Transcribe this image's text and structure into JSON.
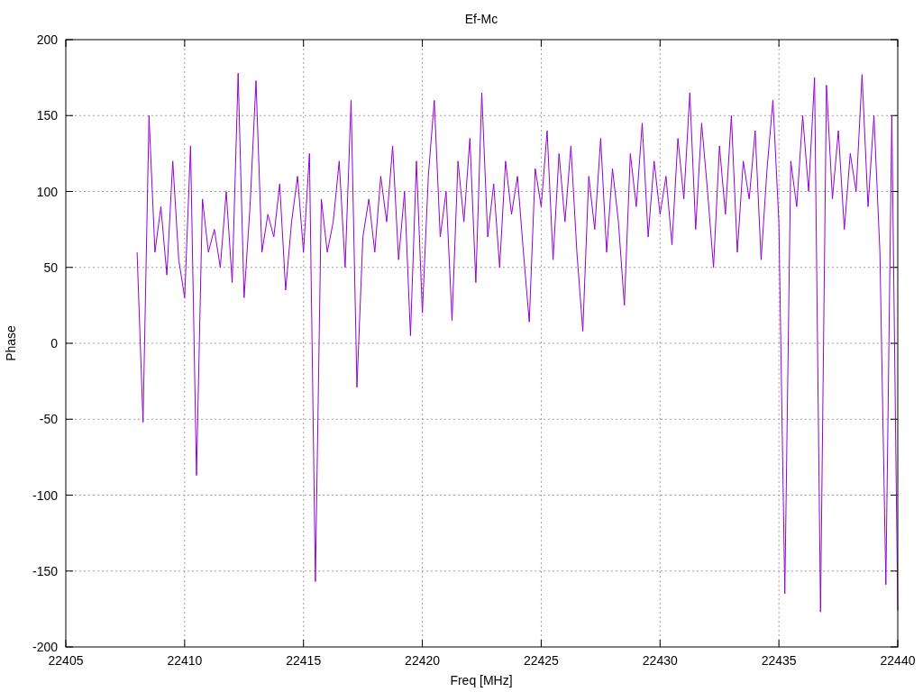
{
  "chart_data": {
    "type": "line",
    "title": "Ef-Mc",
    "xlabel": "Freq [MHz]",
    "ylabel": "Phase",
    "xlim": [
      22405,
      22440
    ],
    "ylim": [
      -200,
      200
    ],
    "xticks": [
      22405,
      22410,
      22415,
      22420,
      22425,
      22430,
      22435,
      22440
    ],
    "yticks": [
      -200,
      -150,
      -100,
      -50,
      0,
      50,
      100,
      150,
      200
    ],
    "x": [
      22408,
      22408.25,
      22408.5,
      22408.75,
      22409,
      22409.25,
      22409.5,
      22409.75,
      22410,
      22410.25,
      22410.5,
      22410.75,
      22411,
      22411.25,
      22411.5,
      22411.75,
      22412,
      22412.25,
      22412.5,
      22412.75,
      22413,
      22413.25,
      22413.5,
      22413.75,
      22414,
      22414.25,
      22414.5,
      22414.75,
      22415,
      22415.25,
      22415.5,
      22415.75,
      22416,
      22416.25,
      22416.5,
      22416.75,
      22417,
      22417.25,
      22417.5,
      22417.75,
      22418,
      22418.25,
      22418.5,
      22418.75,
      22419,
      22419.25,
      22419.5,
      22419.75,
      22420,
      22420.25,
      22420.5,
      22420.75,
      22421,
      22421.25,
      22421.5,
      22421.75,
      22422,
      22422.25,
      22422.5,
      22422.75,
      22423,
      22423.25,
      22423.5,
      22423.75,
      22424,
      22424.25,
      22424.5,
      22424.75,
      22425,
      22425.25,
      22425.5,
      22425.75,
      22426,
      22426.25,
      22426.5,
      22426.75,
      22427,
      22427.25,
      22427.5,
      22427.75,
      22428,
      22428.25,
      22428.5,
      22428.75,
      22429,
      22429.25,
      22429.5,
      22429.75,
      22430,
      22430.25,
      22430.5,
      22430.75,
      22431,
      22431.25,
      22431.5,
      22431.75,
      22432,
      22432.25,
      22432.5,
      22432.75,
      22433,
      22433.25,
      22433.5,
      22433.75,
      22434,
      22434.25,
      22434.5,
      22434.75,
      22435,
      22435.25,
      22435.5,
      22435.75,
      22436,
      22436.25,
      22436.5,
      22436.75,
      22437,
      22437.25,
      22437.5,
      22437.75,
      22438,
      22438.25,
      22438.5,
      22438.75,
      22439,
      22439.25,
      22439.5,
      22439.75,
      22440
    ],
    "grid": true,
    "series": [
      {
        "color": "#9400d3",
        "values": [
          60,
          -52,
          150,
          60,
          90,
          45,
          120,
          55,
          30,
          130,
          -87,
          95,
          60,
          75,
          50,
          100,
          40,
          178,
          30,
          90,
          173,
          60,
          85,
          70,
          105,
          35,
          80,
          110,
          60,
          125,
          -157,
          95,
          60,
          80,
          120,
          50,
          160,
          -29,
          70,
          95,
          60,
          110,
          80,
          130,
          55,
          100,
          5,
          120,
          20,
          110,
          160,
          70,
          100,
          15,
          120,
          80,
          135,
          40,
          165,
          70,
          105,
          50,
          120,
          85,
          110,
          60,
          14,
          115,
          90,
          140,
          55,
          125,
          80,
          130,
          60,
          8,
          110,
          75,
          135,
          60,
          115,
          80,
          25,
          125,
          90,
          145,
          70,
          120,
          85,
          110,
          65,
          135,
          95,
          165,
          75,
          145,
          100,
          50,
          130,
          85,
          150,
          60,
          120,
          95,
          140,
          55,
          115,
          160,
          80,
          -165,
          120,
          90,
          150,
          100,
          175,
          -177,
          170,
          95,
          140,
          75,
          125,
          100,
          177,
          90,
          150,
          60,
          -159,
          150,
          -176
        ]
      }
    ]
  }
}
